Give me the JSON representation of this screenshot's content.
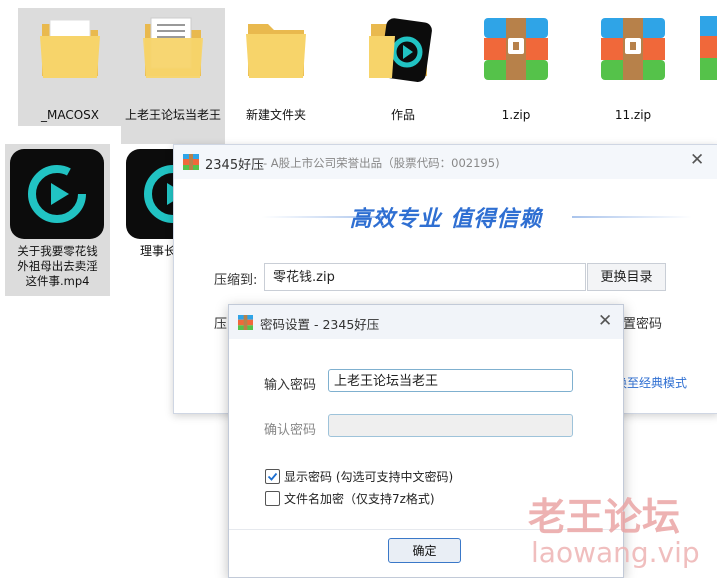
{
  "desktop": {
    "files": [
      {
        "name": "_MACOSX",
        "icon": "folder-icon"
      },
      {
        "name": "上老王论坛当老王",
        "icon": "folder-icon"
      },
      {
        "name": "新建文件夹",
        "icon": "folder-icon"
      },
      {
        "name": "作品",
        "icon": "folder-video-icon"
      },
      {
        "name": "1.zip",
        "icon": "zip-archive-icon"
      },
      {
        "name": "11.zip",
        "icon": "zip-archive-icon"
      },
      {
        "name": "关于我要零花钱外祖母出去卖淫这件事.mp4",
        "icon": "video-player-icon"
      },
      {
        "name": "理事长",
        "icon": "video-player-icon"
      }
    ]
  },
  "main_dialog": {
    "app_name": "2345好压",
    "subtitle": "- A股上市公司荣誉出品（股票代码：002195)",
    "slogan": "高效专业  值得信赖",
    "compress_to_label": "压缩到:",
    "compress_path": "零花钱.zip",
    "change_dir_button": "更换目录",
    "row2_label_partial": "压",
    "set_password_partial": "置密码",
    "classic_mode_link": "换至经典模式"
  },
  "password_dialog": {
    "title": "密码设置 - 2345好压",
    "enter_label": "输入密码",
    "enter_value": "上老王论坛当老王",
    "confirm_label": "确认密码",
    "confirm_value": "",
    "show_password_label": "显示密码 (勾选可支持中文密码)",
    "show_password_checked": true,
    "encrypt_filename_label": "文件名加密（仅支持7z格式)",
    "encrypt_filename_checked": false,
    "ok_button": "确定"
  },
  "watermark": {
    "line1": "老王论坛",
    "line2": "laowang.vip"
  },
  "colors": {
    "accent": "#2f6fd2",
    "folder": "#f7d46a",
    "play_teal": "#21c3c3"
  }
}
